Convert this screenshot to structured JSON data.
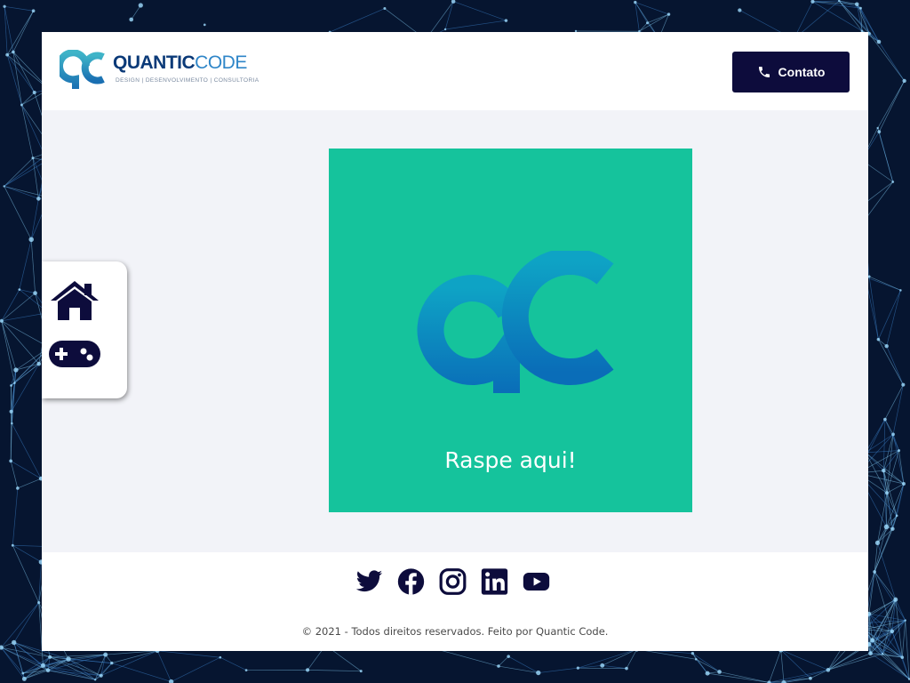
{
  "brand": {
    "name_bold": "QUANTIC",
    "name_light": "CODE",
    "tagline": "DESIGN | DESENVOLVIMENTO | CONSULTORIA"
  },
  "header": {
    "contact_label": "Contato",
    "contact_icon": "phone-icon"
  },
  "sidebar": {
    "items": [
      {
        "icon": "home-icon"
      },
      {
        "icon": "gamepad-icon"
      }
    ]
  },
  "scratch_card": {
    "label": "Raspe aqui!",
    "logo": "qc-logo"
  },
  "footer": {
    "social": [
      {
        "icon": "twitter-icon"
      },
      {
        "icon": "facebook-icon"
      },
      {
        "icon": "instagram-icon"
      },
      {
        "icon": "linkedin-icon"
      },
      {
        "icon": "youtube-icon"
      }
    ],
    "copyright": "© 2021 - Todos direitos reservados. Feito por Quantic Code."
  },
  "colors": {
    "accent_dark": "#0d0c3c",
    "scratch_green": "#15c39c",
    "logo_blue": "#0a6db8",
    "background_dark": "#061530"
  }
}
